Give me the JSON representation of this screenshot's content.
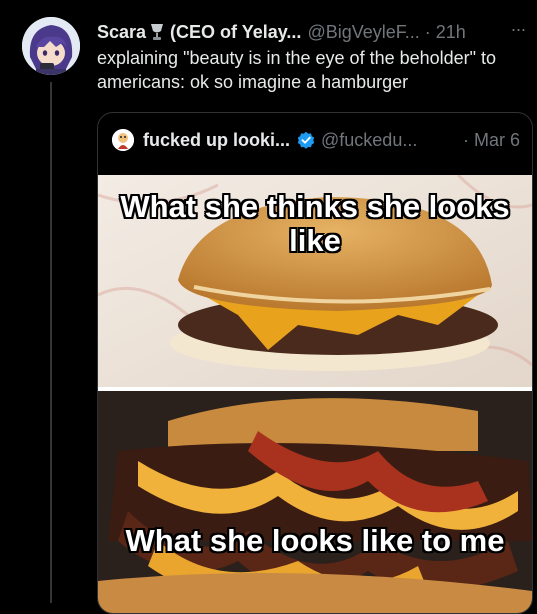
{
  "tweet": {
    "author_name": "Scara",
    "author_badge": "(CEO of Yelay...",
    "handle": "@BigVeyleF...",
    "separator": "·",
    "time": "21h",
    "more": "···",
    "text": "explaining \"beauty is in the eye of the beholder\" to americans: ok so imagine a hamburger"
  },
  "quoted_tweet": {
    "author_name": "fucked up looki...",
    "handle": "@fuckedu...",
    "separator": "·",
    "time": "Mar 6",
    "meme": {
      "top_caption": "What she thinks she looks like",
      "bottom_caption": "What she looks like to me"
    }
  },
  "colors": {
    "background": "#000000",
    "primary_text": "#e7e9ea",
    "secondary_text": "#71767b",
    "verified": "#1d9bf0",
    "border": "#2f3336"
  }
}
